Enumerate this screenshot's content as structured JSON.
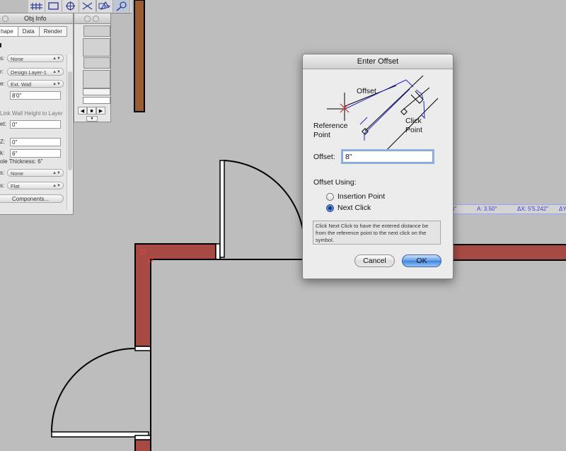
{
  "dialog": {
    "title": "Enter Offset",
    "diagram": {
      "offset_label": "Offset",
      "reference_label_1": "Reference",
      "reference_label_2": "Point",
      "click_label_1": "Click",
      "click_label_2": "Point"
    },
    "offset_label": "Offset:",
    "offset_value": "8\"",
    "offset_using_label": "Offset Using:",
    "options": [
      {
        "label": "Insertion Point",
        "selected": false
      },
      {
        "label": "Next Click",
        "selected": true
      }
    ],
    "help_text": "Click Next Click to have the entered distance be from the reference point to the next click on the symbol.",
    "cancel_label": "Cancel",
    "ok_label": "OK"
  },
  "obj_info": {
    "title": "Obj Info",
    "tabs": [
      "hape",
      "Data",
      "Render"
    ],
    "rows": {
      "class_label": "s:",
      "class_value": "None",
      "layer_label": "r:",
      "layer_value": "Design Layer-1",
      "style_label": "e:",
      "style_value": "Ext. Wall",
      "height_value": "8'0\"",
      "link_label": "Link Wall Height to Layer",
      "offset_label": "et:",
      "offset_value": "0\"",
      "z_label": "Z:",
      "z_value": "0\"",
      "thick_label": "k:",
      "thick_value": "6\"",
      "overall_label": "ole Thickness: 6\"",
      "caps_label": "s:",
      "caps_value": "None",
      "ends_label": "s:",
      "ends_value": "Flat",
      "components_label": "Components..."
    }
  },
  "coord_bar": {
    "left_text": "4\"",
    "angle_text": "A: 3.50°",
    "dx_text": "ΔX: 5'5.242\"",
    "dy_text": "ΔY"
  },
  "colors": {
    "wall_fill": "#a84a44",
    "column_fill": "#9a5c30",
    "background": "#bdbdbd",
    "dimension_blue": "#2424c8",
    "accent_red": "#d23030"
  },
  "icons": {
    "tool_icons": [
      "grid-icon",
      "rect-icon",
      "target-icon",
      "cross-icon",
      "rect-dot-icon",
      "line-icon",
      "rotate-icon",
      "zoom-icon"
    ],
    "palette_close": "close-icon"
  }
}
